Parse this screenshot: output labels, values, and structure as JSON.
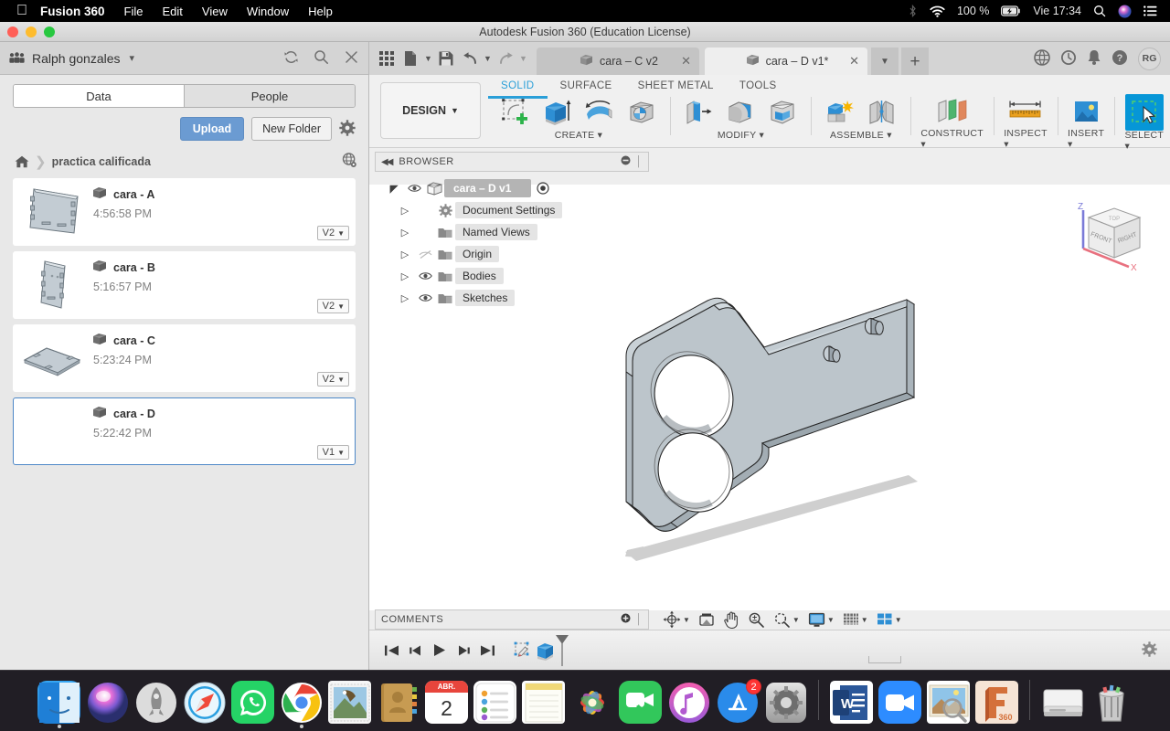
{
  "mac_menu": {
    "apple_icon": "apple-icon",
    "app_name": "Fusion 360",
    "items": [
      "File",
      "Edit",
      "View",
      "Window",
      "Help"
    ],
    "status": {
      "bluetooth_icon": "bluetooth-icon",
      "wifi_icon": "wifi-icon",
      "battery_percent": "100 %",
      "battery_icon": "battery-charging-icon",
      "clock": "Vie 17:34",
      "search_icon": "spotlight-search-icon",
      "siri_icon": "siri-icon",
      "controlcenter_icon": "notification-center-icon"
    }
  },
  "window": {
    "title": "Autodesk Fusion 360 (Education License)",
    "close_color": "#ff5f57",
    "minimize_color": "#febc2e",
    "zoom_color": "#28c840"
  },
  "data_panel": {
    "user_name": "Ralph gonzales",
    "user_caret": "chevron-down-icon",
    "people_icon": "people-group-icon",
    "refresh_icon": "refresh-icon",
    "search_icon": "search-icon",
    "close_icon": "close-icon",
    "tabs": [
      {
        "label": "Data",
        "active": true
      },
      {
        "label": "People",
        "active": false
      }
    ],
    "upload_label": "Upload",
    "new_folder_label": "New Folder",
    "settings_icon": "gear-icon",
    "breadcrumb": {
      "home_icon": "home-icon",
      "separator": "chevron-right-icon",
      "folder": "practica calificada",
      "globe_icon": "globe-view-icon"
    },
    "files": [
      {
        "name": "cara - A",
        "time": "4:56:58 PM",
        "version": "V2",
        "selected": false,
        "thumb": "plate-a"
      },
      {
        "name": "cara - B",
        "time": "5:16:57 PM",
        "version": "V2",
        "selected": false,
        "thumb": "plate-b"
      },
      {
        "name": "cara - C",
        "time": "5:23:24 PM",
        "version": "V2",
        "selected": false,
        "thumb": "plate-c"
      },
      {
        "name": "cara - D",
        "time": "5:22:42 PM",
        "version": "V1",
        "selected": true,
        "thumb": "none"
      }
    ]
  },
  "app_tabs": {
    "grid_icon": "app-grid-icon",
    "new_icon": "new-document-icon",
    "save_icon": "save-icon",
    "undo_icon": "undo-icon",
    "redo_icon": "redo-icon",
    "documents": [
      {
        "label": "cara – C v2",
        "active": false,
        "close_icon": "close-icon"
      },
      {
        "label": "cara – D v1*",
        "active": true,
        "close_icon": "close-icon"
      }
    ],
    "tab_dropdown_icon": "chevron-down-icon",
    "add_tab_icon": "plus-icon",
    "extensions_icon": "extensions-globe-icon",
    "job_status_icon": "job-status-clock-icon",
    "notifications_icon": "bell-icon",
    "help_icon": "help-question-icon",
    "avatar_initials": "RG"
  },
  "ribbon": {
    "workspace": "DESIGN",
    "workspace_caret": "chevron-down-icon",
    "tabs": [
      {
        "label": "SOLID",
        "active": true
      },
      {
        "label": "SURFACE",
        "active": false
      },
      {
        "label": "SHEET METAL",
        "active": false
      },
      {
        "label": "TOOLS",
        "active": false
      }
    ],
    "groups": [
      {
        "label": "CREATE",
        "caret": true,
        "icons": [
          "create-sketch-icon",
          "extrude-icon",
          "revolve-icon",
          "sweep-icon"
        ]
      },
      {
        "label": "MODIFY",
        "caret": true,
        "icons": [
          "press-pull-icon",
          "fillet-icon",
          "shell-icon"
        ]
      },
      {
        "label": "ASSEMBLE",
        "caret": true,
        "icons": [
          "new-component-icon",
          "joint-icon"
        ]
      },
      {
        "label": "CONSTRUCT",
        "caret": true,
        "icons": [
          "offset-plane-icon"
        ]
      },
      {
        "label": "INSPECT",
        "caret": true,
        "icons": [
          "measure-ruler-icon"
        ]
      },
      {
        "label": "INSERT",
        "caret": true,
        "icons": [
          "insert-image-icon"
        ]
      },
      {
        "label": "SELECT",
        "caret": true,
        "icons": [
          "select-window-icon"
        ]
      }
    ]
  },
  "browser": {
    "title": "BROWSER",
    "collapse_icon": "collapse-left-icon",
    "minus_icon": "minimize-circle-icon",
    "grip_icon": "panel-grip-icon",
    "nodes": [
      {
        "label": "cara – D v1",
        "level": 0,
        "eye": "visible",
        "icon": "component-icon",
        "root": true,
        "radio": "activate-radio-icon"
      },
      {
        "label": "Document Settings",
        "level": 1,
        "eye": "none",
        "icon": "gear-icon"
      },
      {
        "label": "Named Views",
        "level": 1,
        "eye": "none",
        "icon": "folder-icon"
      },
      {
        "label": "Origin",
        "level": 1,
        "eye": "hidden",
        "icon": "folder-icon"
      },
      {
        "label": "Bodies",
        "level": 1,
        "eye": "visible",
        "icon": "folder-icon"
      },
      {
        "label": "Sketches",
        "level": 1,
        "eye": "visible",
        "icon": "folder-icon"
      }
    ]
  },
  "viewcube": {
    "front_label": "FRONT",
    "right_label": "RIGHT",
    "top_label": "TOP",
    "z_axis_label": "Z",
    "x_axis_label": "X",
    "z_axis_color": "#7b7bd8",
    "x_axis_color": "#e8717f"
  },
  "canvas": {
    "background_top": "#ffffff",
    "background_bottom": "#ffffff",
    "model_fill": "#b9c2c9",
    "model_shadow": "#cfcfcf",
    "description": "isometric bracket plate with two large through holes and two small pins"
  },
  "comments": {
    "title": "COMMENTS",
    "add_icon": "add-comment-icon",
    "grip_icon": "panel-grip-icon"
  },
  "navbar": {
    "items": [
      {
        "icon": "orbit-icon",
        "caret": true
      },
      {
        "icon": "pan-look-at-icon",
        "caret": false
      },
      {
        "icon": "pan-hand-icon",
        "caret": false
      },
      {
        "icon": "zoom-icon",
        "caret": false
      },
      {
        "icon": "fit-icon",
        "caret": true
      },
      {
        "icon": "display-settings-icon",
        "caret": true
      },
      {
        "icon": "grid-snaps-icon",
        "caret": true
      },
      {
        "icon": "viewports-icon",
        "caret": true
      }
    ]
  },
  "timeline": {
    "buttons": [
      {
        "icon": "go-to-beginning-icon"
      },
      {
        "icon": "step-back-icon"
      },
      {
        "icon": "play-icon"
      },
      {
        "icon": "step-forward-icon"
      },
      {
        "icon": "go-to-end-icon"
      }
    ],
    "features": [
      {
        "icon": "sketch-feature-icon"
      },
      {
        "icon": "extrude-feature-icon"
      }
    ],
    "marker_icon": "timeline-marker-icon",
    "settings_icon": "gear-icon"
  },
  "dock": {
    "items": [
      {
        "name": "finder",
        "label": "Finder",
        "running": true
      },
      {
        "name": "siri",
        "label": "Siri",
        "running": false
      },
      {
        "name": "launchpad",
        "label": "Launchpad",
        "running": false
      },
      {
        "name": "safari",
        "label": "Safari",
        "running": false
      },
      {
        "name": "whatsapp",
        "label": "WhatsApp",
        "running": false
      },
      {
        "name": "chrome",
        "label": "Google Chrome",
        "running": true
      },
      {
        "name": "mail",
        "label": "Mail",
        "running": false
      },
      {
        "name": "contacts",
        "label": "Contacts",
        "running": false
      },
      {
        "name": "calendar",
        "label": "Calendar",
        "running": false,
        "month": "ABR.",
        "day": "2"
      },
      {
        "name": "reminders",
        "label": "Reminders",
        "running": false
      },
      {
        "name": "notes",
        "label": "Notes",
        "running": false
      },
      {
        "name": "photos",
        "label": "Photos",
        "running": false
      },
      {
        "name": "facetime",
        "label": "FaceTime",
        "running": false
      },
      {
        "name": "itunes",
        "label": "iTunes",
        "running": false
      },
      {
        "name": "appstore",
        "label": "App Store",
        "running": false,
        "badge": "2"
      },
      {
        "name": "system-prefs",
        "label": "System Preferences",
        "running": false
      },
      {
        "name": "separator-1",
        "label": "",
        "running": false
      },
      {
        "name": "word",
        "label": "Microsoft Word",
        "running": false,
        "glyph": "W"
      },
      {
        "name": "zoom",
        "label": "Zoom",
        "running": false
      },
      {
        "name": "preview",
        "label": "Preview",
        "running": true
      },
      {
        "name": "fusion360",
        "label": "Fusion 360",
        "running": true,
        "glyph": "360"
      },
      {
        "name": "separator-2",
        "label": "",
        "running": false
      },
      {
        "name": "disk",
        "label": "Disk",
        "running": false
      },
      {
        "name": "trash",
        "label": "Trash",
        "running": false
      }
    ]
  }
}
